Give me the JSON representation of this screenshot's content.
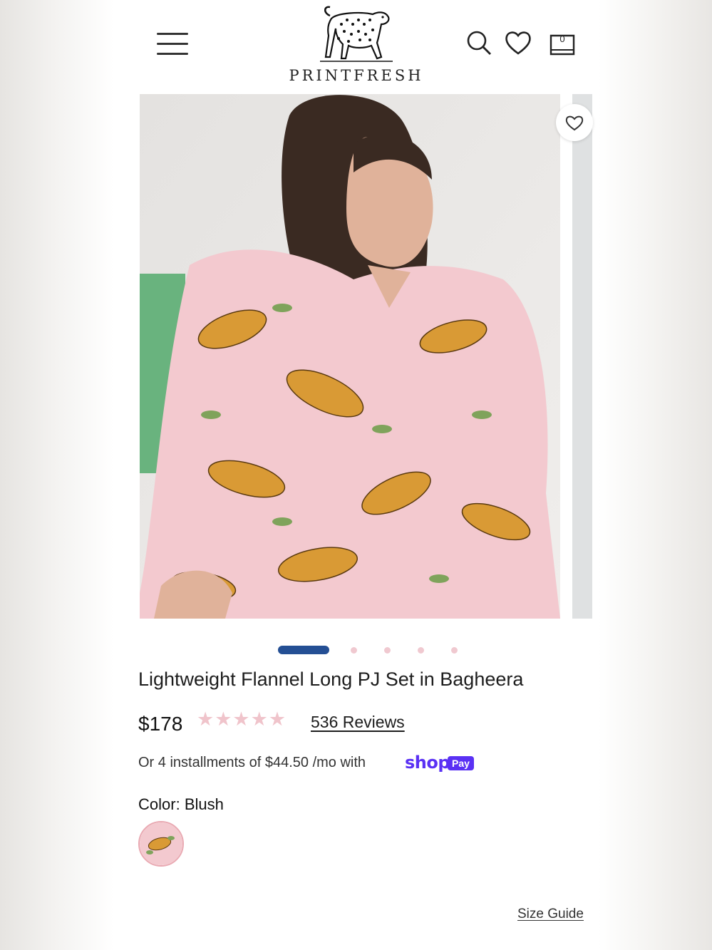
{
  "header": {
    "brand": "PRINTFRESH",
    "cart_count": "0",
    "icons": [
      "menu-icon",
      "search-icon",
      "heart-icon",
      "bag-icon"
    ]
  },
  "gallery": {
    "slide_count": 5,
    "active_slide": 1,
    "wishlist_icon": "heart-icon",
    "colors": {
      "blush": "#f3c9cf",
      "leopard": "#d99a35",
      "leaf": "#7fa35b",
      "accent_green": "#69b37e"
    }
  },
  "product": {
    "title": "Lightweight Flannel Long PJ Set in Bagheera",
    "price": "$178",
    "rating": 5,
    "stars": "★★★★★",
    "reviews": "536 Reviews",
    "installments": "Or 4 installments of $44.50 /mo with",
    "shop_logo": "shop",
    "shop_pay_badge": "Pay",
    "color_label": "Color:",
    "color_value": "Blush",
    "size_guide": "Size Guide"
  },
  "theme": {
    "active_dot": "#244f94",
    "dot": "#f0c9d0",
    "star": "#f0c4cb",
    "shop_pay": "#5a31f4"
  }
}
